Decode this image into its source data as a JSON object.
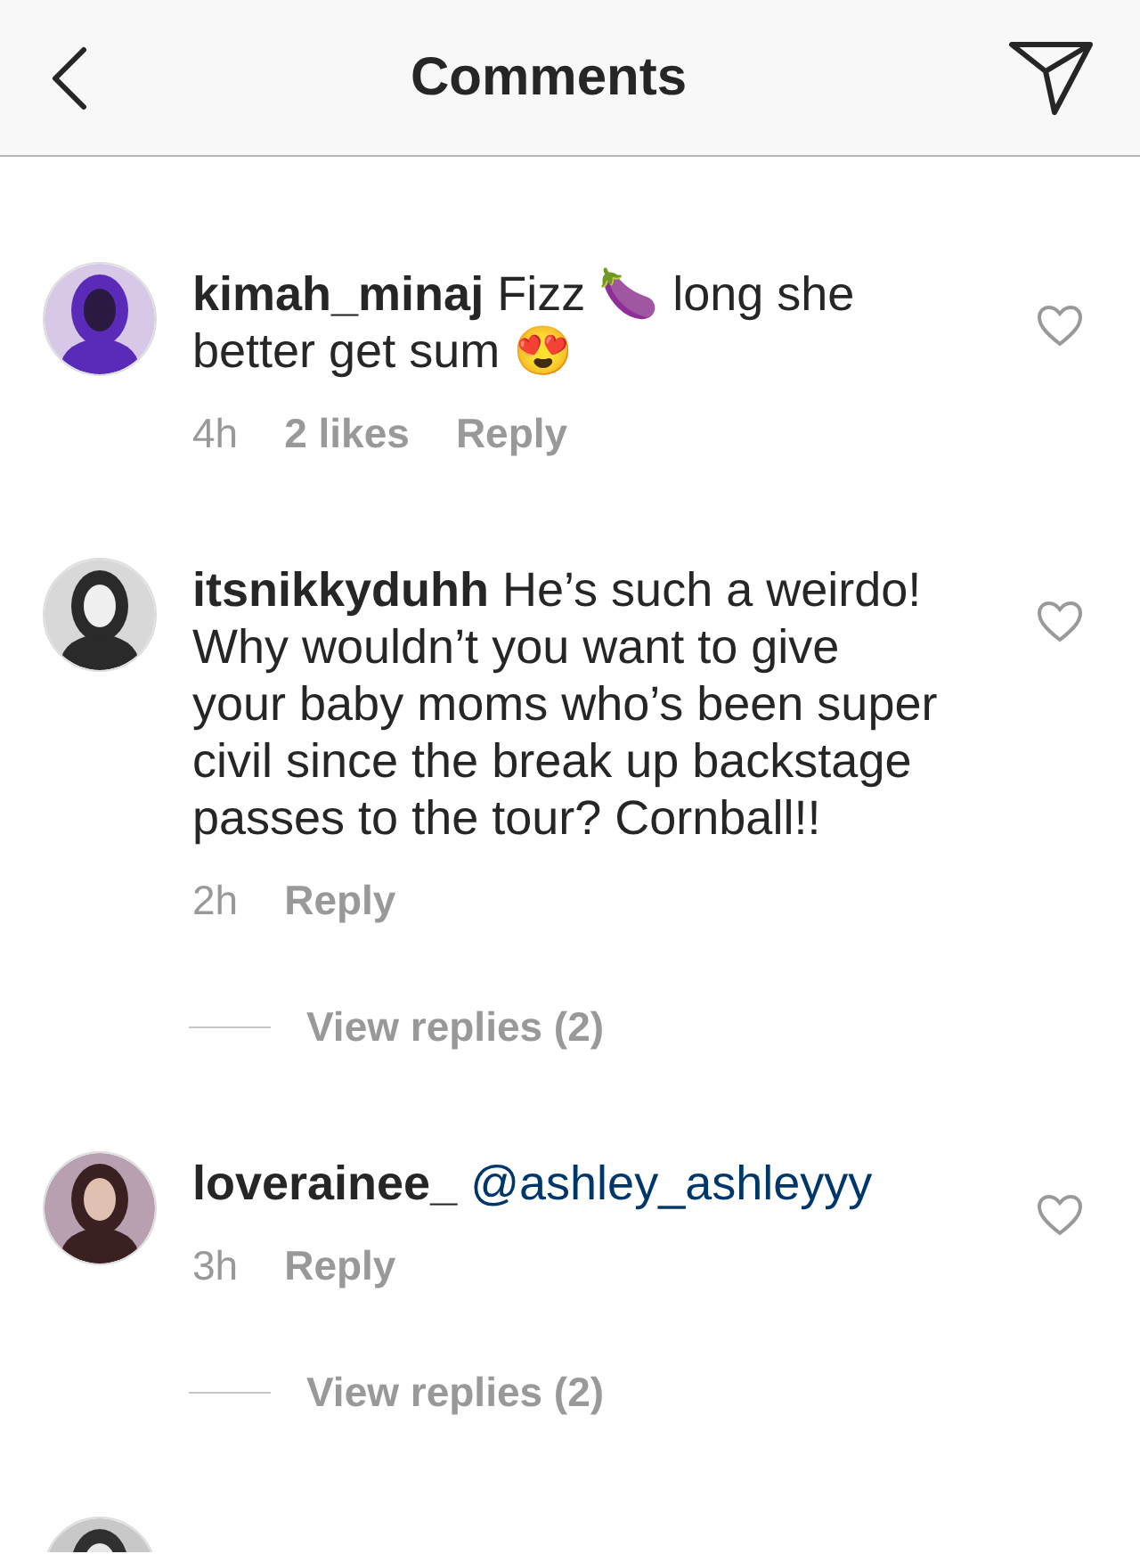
{
  "header": {
    "title": "Comments"
  },
  "comments": [
    {
      "text": "**kimah_minaj** Fizz 🍆 long she better get sum 😍",
      "time": "4h",
      "likes": "2 likes",
      "reply": "Reply",
      "liked": false,
      "avatar": {
        "kind": "picture"
      }
    },
    {
      "text": "**itsnikkyduhh** He’s such a weirdo! Why wouldn’t you want to give your baby moms who’s been super civil since the break up backstage passes to the tour? Cornball!!",
      "time": "2h",
      "reply": "Reply",
      "liked": false,
      "avatar": {
        "kind": "picture"
      },
      "view_replies": "View replies (2)"
    },
    {
      "text": "**loverainee_**",
      "mention": "@ashley_ashleyyy",
      "time": "3h",
      "reply": "Reply",
      "liked": false,
      "avatar": {
        "kind": "picture"
      },
      "view_replies": "View replies (2)"
    },
    {
      "avatar": {
        "kind": "picture"
      }
    }
  ]
}
